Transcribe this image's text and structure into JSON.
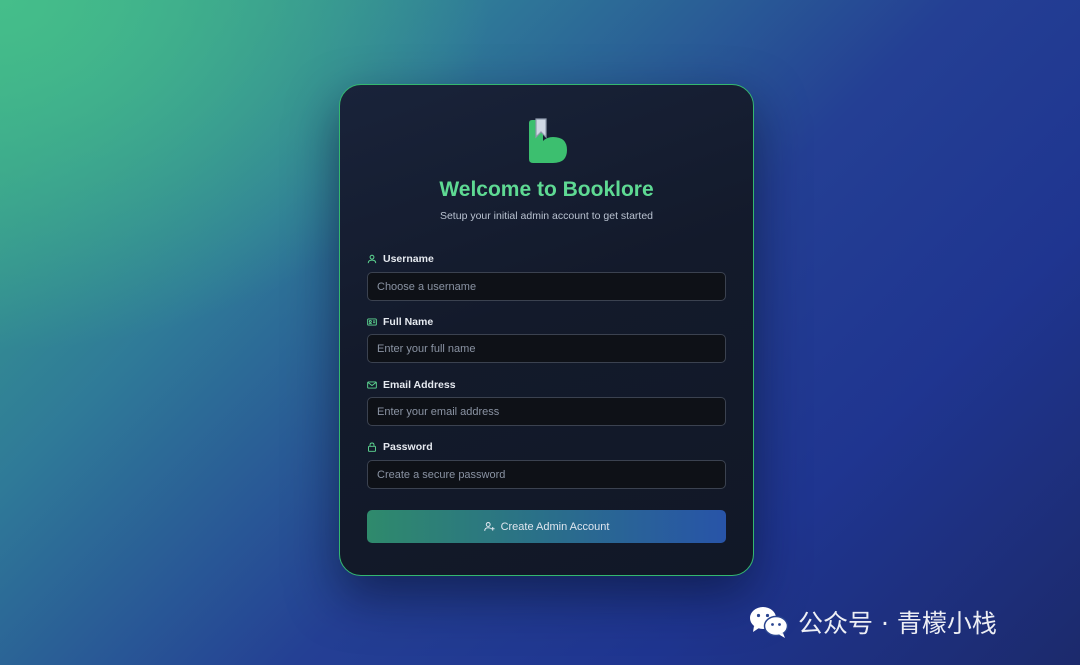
{
  "card": {
    "title": "Welcome to Booklore",
    "subtitle": "Setup your initial admin account to get started"
  },
  "fields": [
    {
      "label": "Username",
      "placeholder": "Choose a username",
      "value": "",
      "icon": "user-icon"
    },
    {
      "label": "Full Name",
      "placeholder": "Enter your full name",
      "value": "",
      "icon": "id-card-icon"
    },
    {
      "label": "Email Address",
      "placeholder": "Enter your email address",
      "value": "",
      "icon": "envelope-icon"
    },
    {
      "label": "Password",
      "placeholder": "Create a secure password",
      "value": "",
      "icon": "lock-icon"
    }
  ],
  "submit": {
    "label": "Create Admin Account",
    "icon": "user-plus-icon"
  },
  "watermark": {
    "text": "公众号 · 青檬小栈",
    "icon": "wechat-icon"
  },
  "colors": {
    "accent": "#5ed993",
    "border": "#34b86f",
    "card_bg": "#131a2b",
    "input_bg": "#0e1117"
  }
}
